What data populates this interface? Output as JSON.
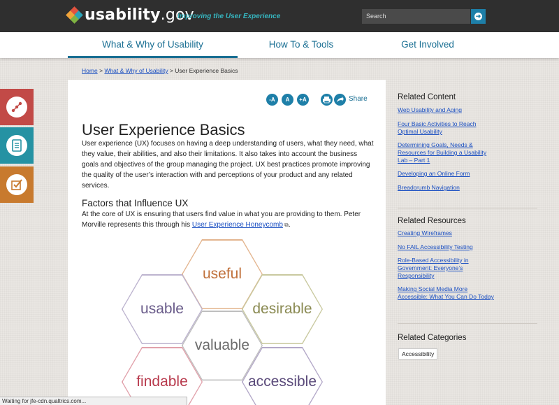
{
  "header": {
    "logo_text_main": "usability",
    "logo_text_suffix": ".gov",
    "tagline": "Improving the User Experience",
    "search_placeholder": "Search"
  },
  "nav": {
    "items": [
      {
        "label": "What & Why of Usability"
      },
      {
        "label": "How To & Tools"
      },
      {
        "label": "Get Involved"
      }
    ]
  },
  "breadcrumb": {
    "home": "Home",
    "sep1": ">",
    "section": "What & Why of Usability",
    "sep2": ">",
    "current": "User Experience Basics"
  },
  "tools": {
    "font_smaller": "-A",
    "font_normal": "A",
    "font_larger": "+A",
    "share_label": "Share"
  },
  "article": {
    "title": "User Experience Basics",
    "intro": "User experience (UX) focuses on having a deep understanding of users, what they need, what they value, their abilities, and also their limitations.  It also takes into account the business goals and objectives of the group managing the project. UX best practices promote improving the quality of the user’s interaction with and perceptions of your product and any related services.",
    "section_heading": "Factors that Influence UX",
    "section_text_before": "At the core of UX is ensuring that users find value in what you are providing to them.  Peter Morville represents this through his ",
    "section_link": "User Experience Honeycomb",
    "section_text_after": ".",
    "honeycomb": [
      {
        "label": "useful",
        "color": "#c0703a",
        "border": "#e3b58f"
      },
      {
        "label": "usable",
        "color": "#6a5c8a",
        "border": "#bdb4cf"
      },
      {
        "label": "desirable",
        "color": "#8a8a52",
        "border": "#c9c99f"
      },
      {
        "label": "valuable",
        "color": "#6b6b6b",
        "border": "#bfbfbf"
      },
      {
        "label": "findable",
        "color": "#b83a4d",
        "border": "#e1a1ab"
      },
      {
        "label": "accessible",
        "color": "#5a4a7a",
        "border": "#b3a8c8"
      }
    ]
  },
  "related_content": {
    "heading": "Related Content",
    "links": [
      "Web Usability and Aging",
      "Four Basic Activities to Reach Optimal Usability",
      "Determining Goals, Needs & Resources for Building a Usability Lab – Part 1",
      "Developing an Online Form",
      "Breadcrumb Navigation"
    ]
  },
  "related_resources": {
    "heading": "Related Resources",
    "links": [
      "Creating Wireframes",
      "No FAIL Accessibility Testing",
      "Role-Based Accessibility in Government: Everyone’s Responsibility",
      "Making Social Media More Accessible: What You Can Do Today"
    ]
  },
  "related_categories": {
    "heading": "Related Categories",
    "tags": [
      "Accessibility"
    ]
  },
  "status_bar": {
    "text": "Waiting for jfe-cdn.qualtrics.com..."
  },
  "colors": {
    "brand_blue": "#1a6f93",
    "side_tab_red": "#c24a47",
    "side_tab_teal": "#2592a3",
    "side_tab_orange": "#c87a2e"
  }
}
